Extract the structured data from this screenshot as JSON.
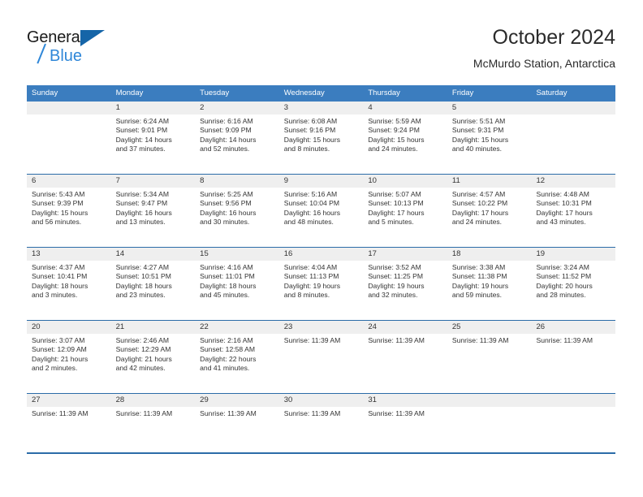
{
  "brand": {
    "name_part1": "General",
    "name_part2": "Blue",
    "logo_icon": "triangle-logo"
  },
  "header": {
    "title": "October 2024",
    "subtitle": "McMurdo Station, Antarctica"
  },
  "colors": {
    "header_blue": "#3b7dbf",
    "rule_blue": "#2b6ca8",
    "daynum_band": "#efefef",
    "brand_blue": "#2f87d8",
    "text": "#333333"
  },
  "weekdays": [
    "Sunday",
    "Monday",
    "Tuesday",
    "Wednesday",
    "Thursday",
    "Friday",
    "Saturday"
  ],
  "weeks": [
    {
      "days": [
        {
          "num": "",
          "lines": []
        },
        {
          "num": "1",
          "lines": [
            "Sunrise: 6:24 AM",
            "Sunset: 9:01 PM",
            "Daylight: 14 hours",
            "and 37 minutes."
          ]
        },
        {
          "num": "2",
          "lines": [
            "Sunrise: 6:16 AM",
            "Sunset: 9:09 PM",
            "Daylight: 14 hours",
            "and 52 minutes."
          ]
        },
        {
          "num": "3",
          "lines": [
            "Sunrise: 6:08 AM",
            "Sunset: 9:16 PM",
            "Daylight: 15 hours",
            "and 8 minutes."
          ]
        },
        {
          "num": "4",
          "lines": [
            "Sunrise: 5:59 AM",
            "Sunset: 9:24 PM",
            "Daylight: 15 hours",
            "and 24 minutes."
          ]
        },
        {
          "num": "5",
          "lines": [
            "Sunrise: 5:51 AM",
            "Sunset: 9:31 PM",
            "Daylight: 15 hours",
            "and 40 minutes."
          ]
        },
        {
          "num": "",
          "lines": []
        }
      ]
    },
    {
      "days": [
        {
          "num": "6",
          "lines": [
            "Sunrise: 5:43 AM",
            "Sunset: 9:39 PM",
            "Daylight: 15 hours",
            "and 56 minutes."
          ]
        },
        {
          "num": "7",
          "lines": [
            "Sunrise: 5:34 AM",
            "Sunset: 9:47 PM",
            "Daylight: 16 hours",
            "and 13 minutes."
          ]
        },
        {
          "num": "8",
          "lines": [
            "Sunrise: 5:25 AM",
            "Sunset: 9:56 PM",
            "Daylight: 16 hours",
            "and 30 minutes."
          ]
        },
        {
          "num": "9",
          "lines": [
            "Sunrise: 5:16 AM",
            "Sunset: 10:04 PM",
            "Daylight: 16 hours",
            "and 48 minutes."
          ]
        },
        {
          "num": "10",
          "lines": [
            "Sunrise: 5:07 AM",
            "Sunset: 10:13 PM",
            "Daylight: 17 hours",
            "and 5 minutes."
          ]
        },
        {
          "num": "11",
          "lines": [
            "Sunrise: 4:57 AM",
            "Sunset: 10:22 PM",
            "Daylight: 17 hours",
            "and 24 minutes."
          ]
        },
        {
          "num": "12",
          "lines": [
            "Sunrise: 4:48 AM",
            "Sunset: 10:31 PM",
            "Daylight: 17 hours",
            "and 43 minutes."
          ]
        }
      ]
    },
    {
      "days": [
        {
          "num": "13",
          "lines": [
            "Sunrise: 4:37 AM",
            "Sunset: 10:41 PM",
            "Daylight: 18 hours",
            "and 3 minutes."
          ]
        },
        {
          "num": "14",
          "lines": [
            "Sunrise: 4:27 AM",
            "Sunset: 10:51 PM",
            "Daylight: 18 hours",
            "and 23 minutes."
          ]
        },
        {
          "num": "15",
          "lines": [
            "Sunrise: 4:16 AM",
            "Sunset: 11:01 PM",
            "Daylight: 18 hours",
            "and 45 minutes."
          ]
        },
        {
          "num": "16",
          "lines": [
            "Sunrise: 4:04 AM",
            "Sunset: 11:13 PM",
            "Daylight: 19 hours",
            "and 8 minutes."
          ]
        },
        {
          "num": "17",
          "lines": [
            "Sunrise: 3:52 AM",
            "Sunset: 11:25 PM",
            "Daylight: 19 hours",
            "and 32 minutes."
          ]
        },
        {
          "num": "18",
          "lines": [
            "Sunrise: 3:38 AM",
            "Sunset: 11:38 PM",
            "Daylight: 19 hours",
            "and 59 minutes."
          ]
        },
        {
          "num": "19",
          "lines": [
            "Sunrise: 3:24 AM",
            "Sunset: 11:52 PM",
            "Daylight: 20 hours",
            "and 28 minutes."
          ]
        }
      ]
    },
    {
      "days": [
        {
          "num": "20",
          "lines": [
            "Sunrise: 3:07 AM",
            "Sunset: 12:09 AM",
            "Daylight: 21 hours",
            "and 2 minutes."
          ]
        },
        {
          "num": "21",
          "lines": [
            "Sunrise: 2:46 AM",
            "Sunset: 12:29 AM",
            "Daylight: 21 hours",
            "and 42 minutes."
          ]
        },
        {
          "num": "22",
          "lines": [
            "Sunrise: 2:16 AM",
            "Sunset: 12:58 AM",
            "Daylight: 22 hours",
            "and 41 minutes."
          ]
        },
        {
          "num": "23",
          "lines": [
            "Sunrise: 11:39 AM"
          ]
        },
        {
          "num": "24",
          "lines": [
            "Sunrise: 11:39 AM"
          ]
        },
        {
          "num": "25",
          "lines": [
            "Sunrise: 11:39 AM"
          ]
        },
        {
          "num": "26",
          "lines": [
            "Sunrise: 11:39 AM"
          ]
        }
      ]
    },
    {
      "short": true,
      "days": [
        {
          "num": "27",
          "lines": [
            "Sunrise: 11:39 AM"
          ]
        },
        {
          "num": "28",
          "lines": [
            "Sunrise: 11:39 AM"
          ]
        },
        {
          "num": "29",
          "lines": [
            "Sunrise: 11:39 AM"
          ]
        },
        {
          "num": "30",
          "lines": [
            "Sunrise: 11:39 AM"
          ]
        },
        {
          "num": "31",
          "lines": [
            "Sunrise: 11:39 AM"
          ]
        },
        {
          "num": "",
          "lines": []
        },
        {
          "num": "",
          "lines": []
        }
      ]
    }
  ]
}
